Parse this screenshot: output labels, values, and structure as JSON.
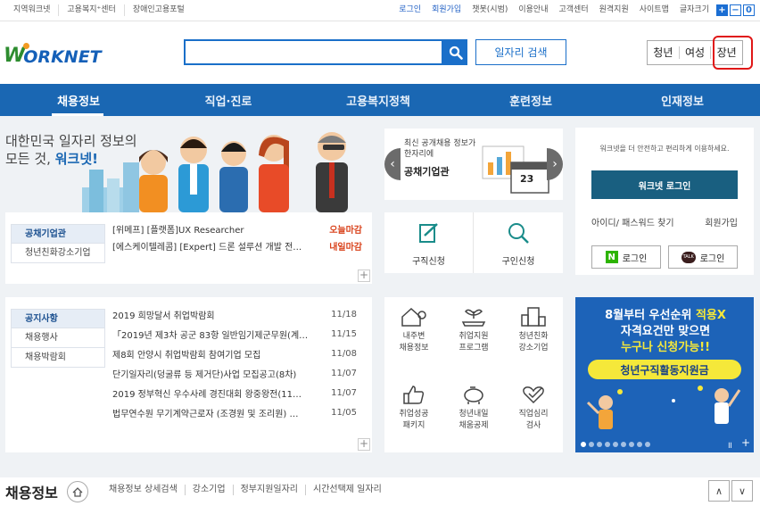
{
  "topbar": {
    "left_links": [
      "지역워크넷",
      "고용복지⁺센터",
      "장애인고용포털"
    ],
    "right_links": [
      "로그인",
      "회원가입",
      "챗봇(시범)",
      "이용안내",
      "고객센터",
      "원격지원",
      "사이트맵"
    ],
    "font_size_label": "글자크기",
    "font_buttons": [
      "+",
      "−",
      "0"
    ]
  },
  "header": {
    "logo_w": "W",
    "logo_rest": "ORKNET",
    "search_placeholder": "",
    "job_search_button": "일자리 검색",
    "modes": [
      "청년",
      "여성",
      "장년"
    ]
  },
  "gnb": {
    "items": [
      "채용정보",
      "직업·진로",
      "고용복지정책",
      "훈련정보",
      "인재정보"
    ]
  },
  "hero": {
    "line1": "대한민국 일자리 정보의",
    "line2_plain": "모든 것, ",
    "line2_accent": "워크넷!"
  },
  "jobs": {
    "tabs": [
      "공채기업관",
      "청년친화강소기업"
    ],
    "rows": [
      {
        "title": "[위메프] [플랫폼]UX Researcher",
        "tag": "오늘마감"
      },
      {
        "title": "[에스케이텔레콤] [Expert] 드론 설루션 개발 전…",
        "tag": "내일마감"
      }
    ]
  },
  "slide": {
    "text1": "최신 공개채용 정보가",
    "text2": "한자리에",
    "title": "공채기업관",
    "calendar_num": "23"
  },
  "quick": {
    "items": [
      "구직신청",
      "구인신청"
    ]
  },
  "login": {
    "notice": "워크넷을 더 안전하고 편리하게 이용하세요.",
    "login_button": "워크넷 로그인",
    "find_label": "아이디/ 패스워드 찾기",
    "join_label": "회원가입",
    "naver_label": "로그인",
    "kakao_label": "로그인",
    "naver_badge": "N",
    "kakao_badge": "TALK"
  },
  "notices": {
    "tabs": [
      "공지사항",
      "채용행사",
      "채용박람회"
    ],
    "rows": [
      {
        "title": "2019 희망달서 취업박람회",
        "date": "11/18"
      },
      {
        "title": "「2019년 제3차 공군 83항 일반임기제군무원(계…",
        "date": "11/15"
      },
      {
        "title": "제8회 안양시 취업박람회 참여기업 모집",
        "date": "11/08"
      },
      {
        "title": "단기일자리(덩굴류 등 제거단)사업 모집공고(8차)",
        "date": "11/07"
      },
      {
        "title": "2019 정부혁신 우수사례 경진대회 왕중왕전(11…",
        "date": "11/07"
      },
      {
        "title": "법무연수원 무기계약근로자 (조경원 및 조리원) …",
        "date": "11/05"
      }
    ]
  },
  "services": {
    "items": [
      {
        "l1": "내주변",
        "l2": "채용정보"
      },
      {
        "l1": "취업지원",
        "l2": "프로그램"
      },
      {
        "l1": "청년친화",
        "l2": "강소기업"
      },
      {
        "l1": "취업성공",
        "l2": "패키지"
      },
      {
        "l1": "청년내일",
        "l2": "채움공제"
      },
      {
        "l1": "직업심리",
        "l2": "검사"
      }
    ]
  },
  "ad": {
    "line1_plain": "8월부터 우선순위 ",
    "line1_accent": "적용X",
    "line2": "자격요건만 맞으면",
    "line3": "누구나 신청가능!!",
    "pill": "청년구직활동지원금"
  },
  "bottom": {
    "title": "채용정보",
    "links": [
      "채용정보 상세검색",
      "강소기업",
      "정부지원일자리",
      "시간선택제 일자리"
    ],
    "up": "∧",
    "down": "∨"
  },
  "colors": {
    "primary": "#1a67b3",
    "highlight_red": "#e01717",
    "deadline_red": "#d9421b",
    "login_button": "#195f80",
    "ad_yellow": "#f5e83a"
  }
}
